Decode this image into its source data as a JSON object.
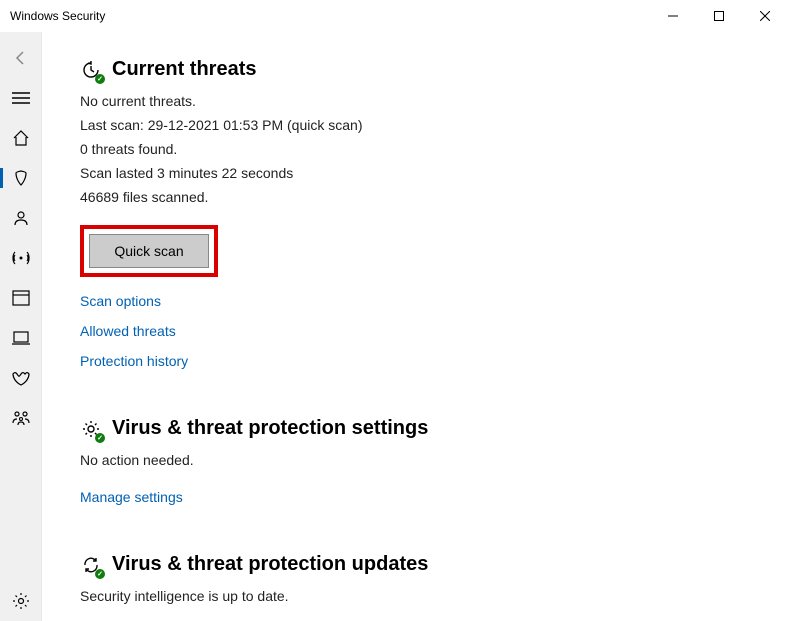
{
  "window": {
    "title": "Windows Security"
  },
  "threats": {
    "heading": "Current threats",
    "no_threats": "No current threats.",
    "last_scan": "Last scan: 29-12-2021 01:53 PM (quick scan)",
    "threats_found": "0 threats found.",
    "duration": "Scan lasted 3 minutes 22 seconds",
    "files": "46689 files scanned.",
    "quick_scan_btn": "Quick scan",
    "link_options": "Scan options",
    "link_allowed": "Allowed threats",
    "link_history": "Protection history"
  },
  "settings": {
    "heading": "Virus & threat protection settings",
    "status": "No action needed.",
    "link_manage": "Manage settings"
  },
  "updates": {
    "heading": "Virus & threat protection updates",
    "status": "Security intelligence is up to date."
  }
}
